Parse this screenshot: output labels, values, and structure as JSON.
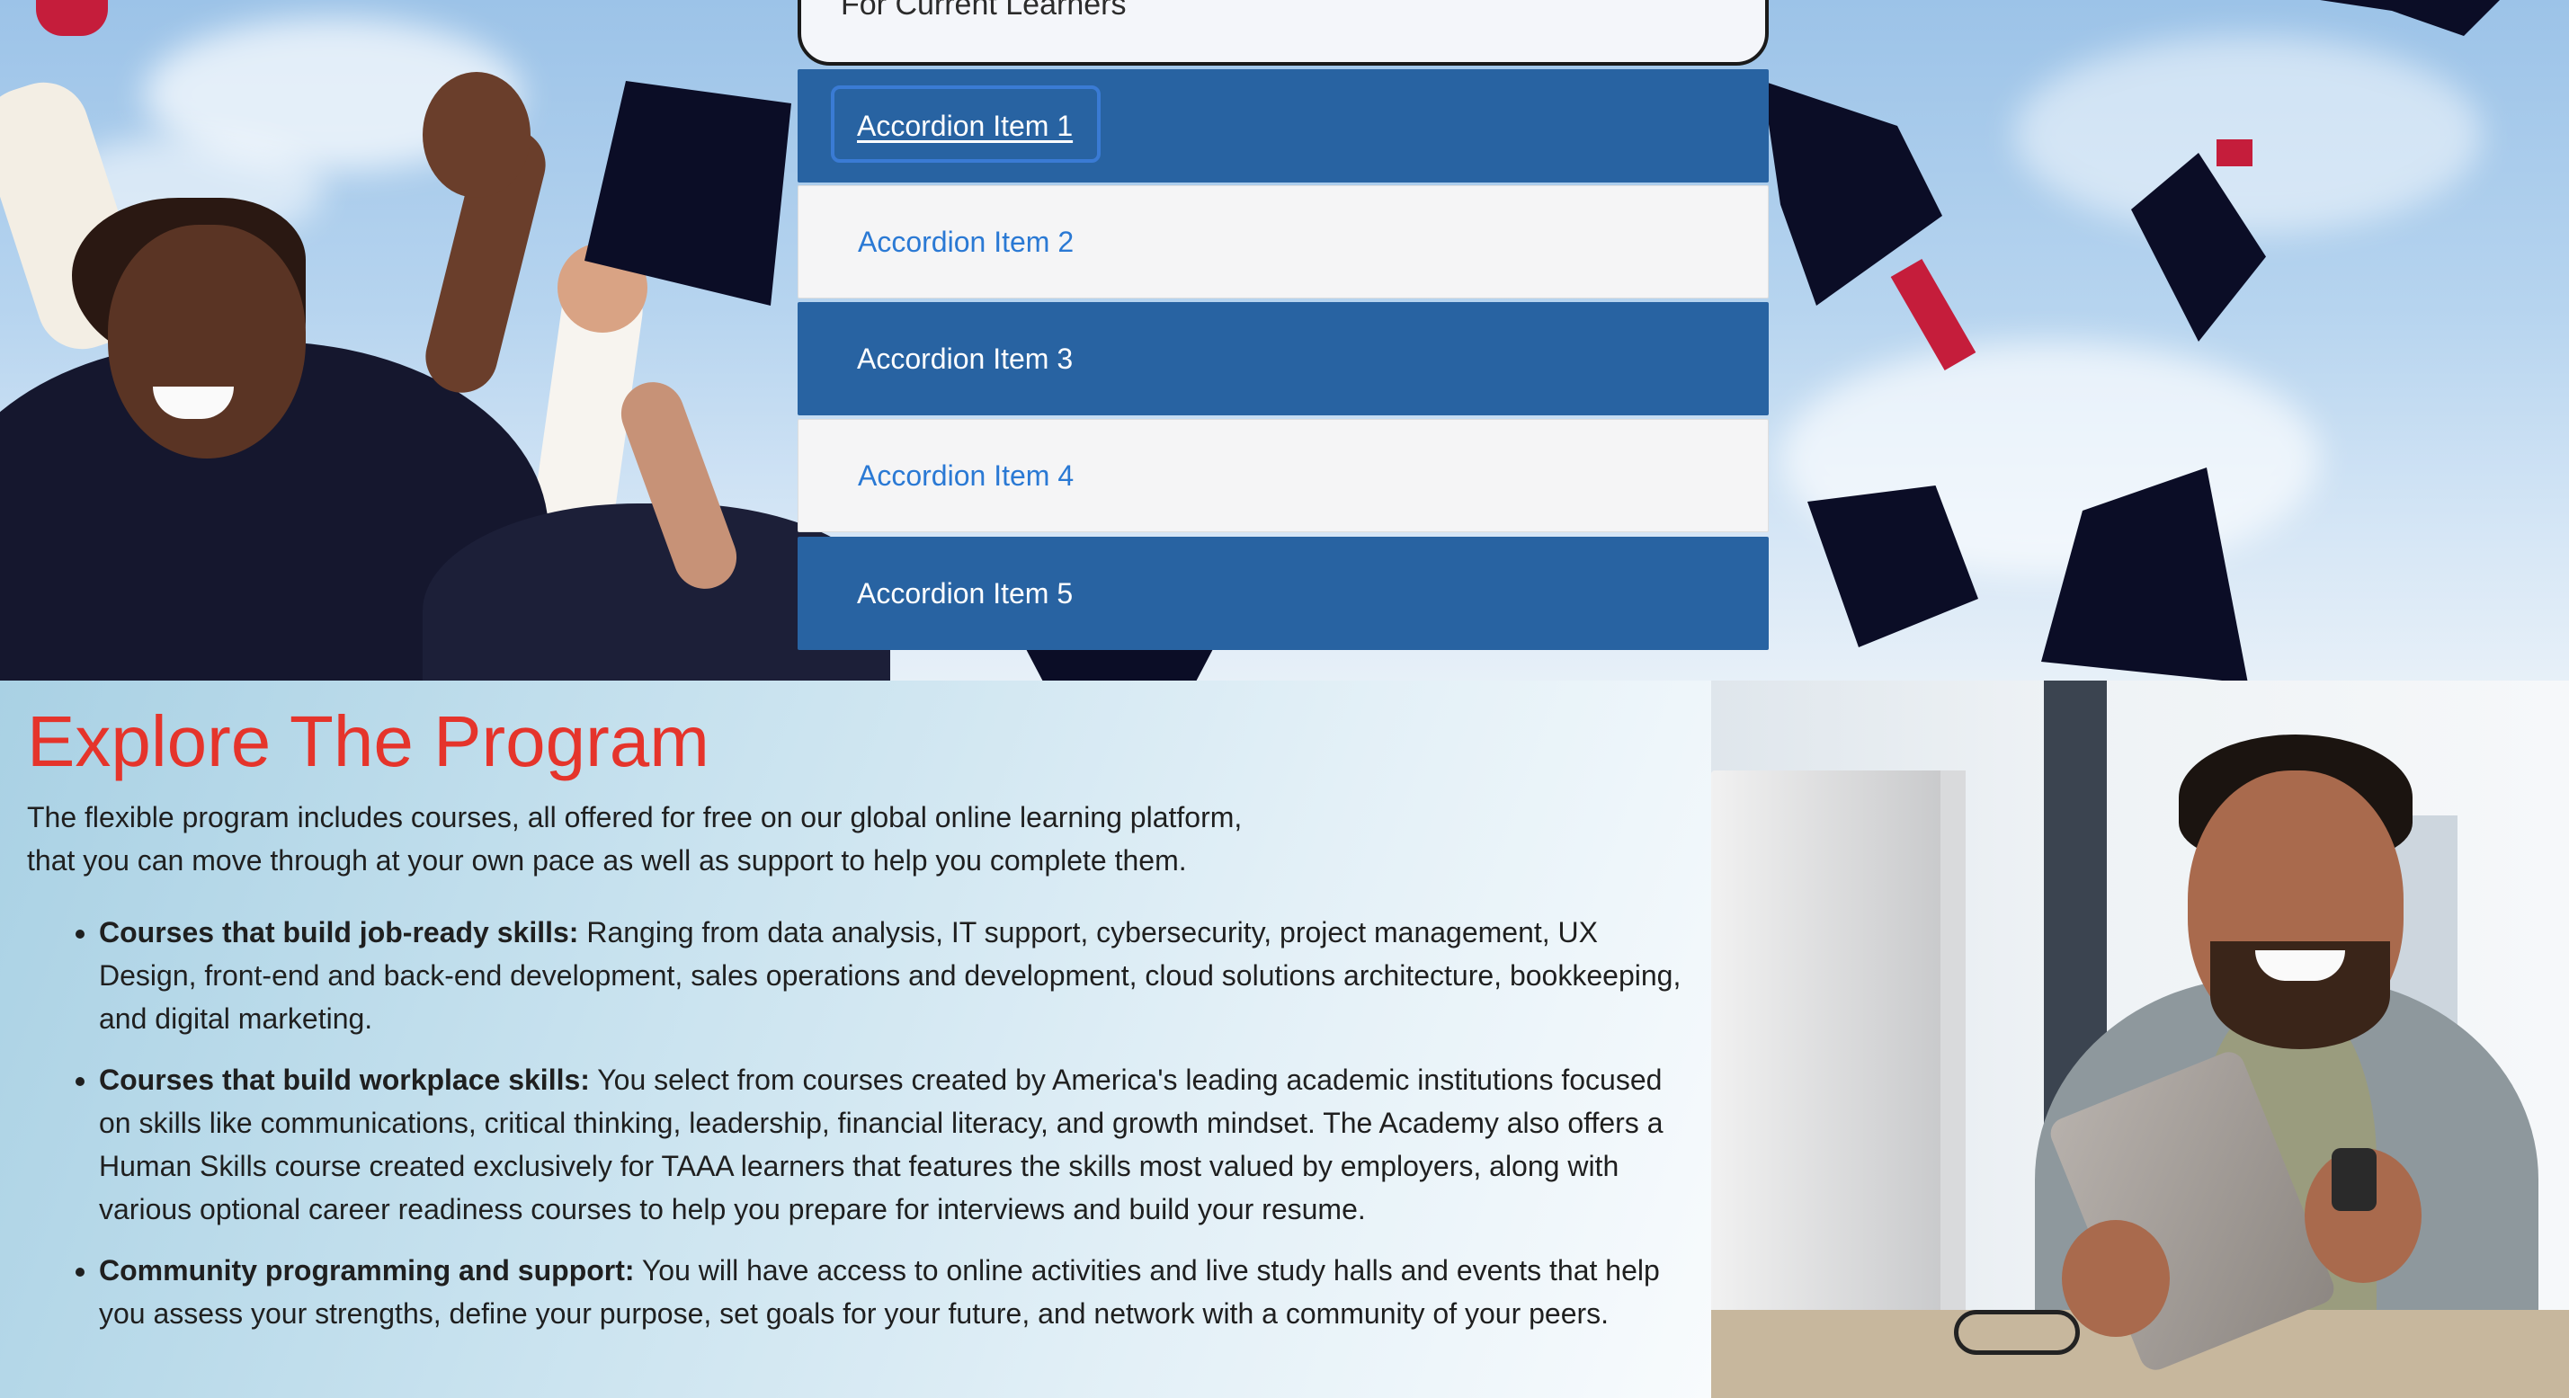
{
  "accordion": {
    "header_label": "For Current Learners",
    "items": [
      {
        "label": "Accordion Item 1"
      },
      {
        "label": "Accordion Item 2"
      },
      {
        "label": "Accordion Item 3"
      },
      {
        "label": "Accordion Item 4"
      },
      {
        "label": "Accordion Item 5"
      }
    ]
  },
  "explore": {
    "title": "Explore The Program",
    "intro_line1": "The flexible program includes courses, all offered for free on our global online learning platform,",
    "intro_line2": "that you can move through at your own pace as well as support to help you complete them.",
    "bullets": [
      {
        "heading": "Courses that build job-ready skills:",
        "text": " Ranging from data analysis, IT support, cybersecurity, project management, UX Design, front-end and back-end development, sales operations and development, cloud solutions architecture, bookkeeping, and digital marketing."
      },
      {
        "heading": "Courses that build workplace skills:",
        "text": " You select from courses created by America's leading academic institutions focused on skills like communications, critical thinking, leadership, financial literacy, and growth mindset. The Academy also offers a Human Skills course created exclusively for TAAA learners that features the skills most valued by employers, along with various optional career readiness courses to help you prepare for interviews and build your resume."
      },
      {
        "heading": "Community programming and support:",
        "text": " You will have access to online activities and live study halls and events that help you assess your strengths, define your purpose, set goals for your future, and network with a community of your peers."
      }
    ]
  },
  "colors": {
    "accordion_dark": "#2863a2",
    "accordion_light": "#f5f5f6",
    "accordion_light_text": "#2a79d4",
    "title_red": "#e5342b",
    "body_text": "#1f1f1f"
  }
}
